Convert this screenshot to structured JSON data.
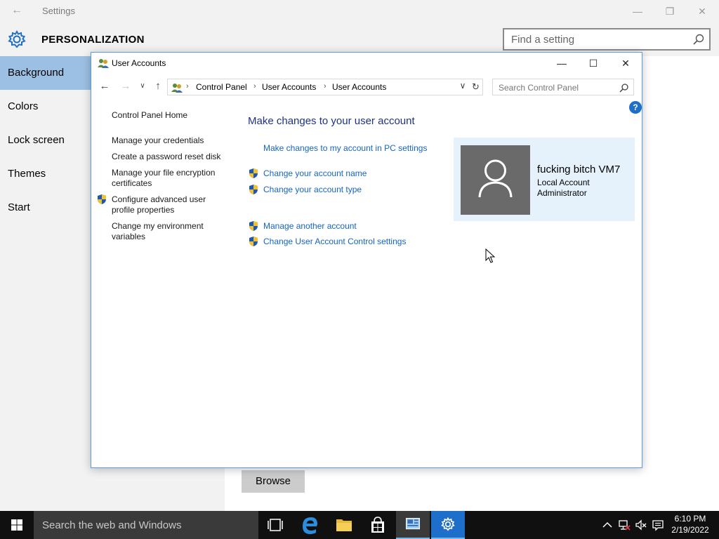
{
  "settings": {
    "app_title": "Settings",
    "section_title": "PERSONALIZATION",
    "search_placeholder": "Find a setting",
    "nav": [
      {
        "label": "Background",
        "active": true
      },
      {
        "label": "Colors",
        "active": false
      },
      {
        "label": "Lock screen",
        "active": false
      },
      {
        "label": "Themes",
        "active": false
      },
      {
        "label": "Start",
        "active": false
      }
    ],
    "browse_label": "Browse"
  },
  "user_accounts": {
    "title": "User Accounts",
    "breadcrumb": [
      "Control Panel",
      "User Accounts",
      "User Accounts"
    ],
    "search_placeholder": "Search Control Panel",
    "help_label": "?",
    "left_links": [
      {
        "label": "Control Panel Home",
        "shield": false
      },
      {
        "label": "Manage your credentials",
        "shield": false
      },
      {
        "label": "Create a password reset disk",
        "shield": false
      },
      {
        "label": "Manage your file encryption certificates",
        "shield": false
      },
      {
        "label": "Configure advanced user profile properties",
        "shield": true
      },
      {
        "label": "Change my environment variables",
        "shield": false
      }
    ],
    "heading": "Make changes to your user account",
    "links": [
      {
        "label": "Make changes to my account in PC settings",
        "shield": false
      },
      {
        "label": "Change your account name",
        "shield": true
      },
      {
        "label": "Change your account type",
        "shield": true
      },
      {
        "label": "Manage another account",
        "shield": true
      },
      {
        "label": "Change User Account Control settings",
        "shield": true
      }
    ],
    "account": {
      "name": "fucking bitch VM7",
      "type": "Local Account",
      "role": "Administrator"
    }
  },
  "taskbar": {
    "search_placeholder": "Search the web and Windows",
    "time": "6:10 PM",
    "date": "2/19/2022"
  },
  "colors": {
    "accent": "#9cc0e3",
    "link": "#1565c0",
    "heading": "#1e3287",
    "taskbar": "#101010"
  }
}
